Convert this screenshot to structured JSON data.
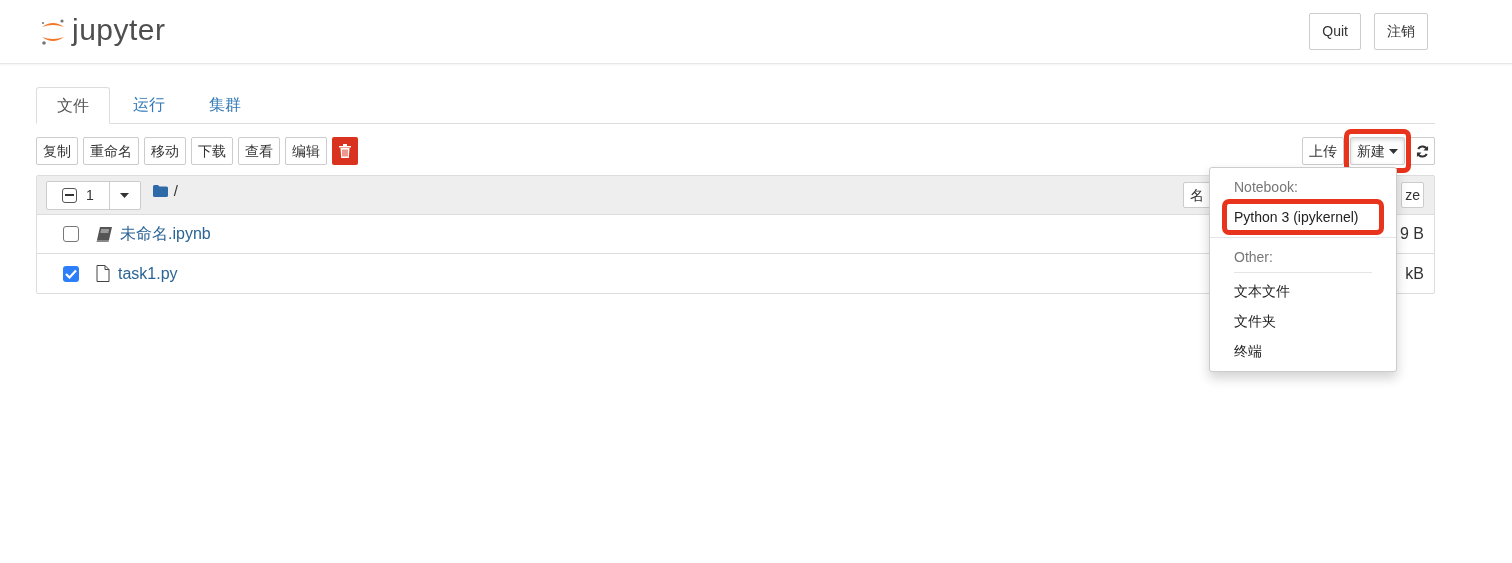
{
  "header": {
    "logo_text": "jupyter",
    "buttons": [
      "Quit",
      "注销"
    ]
  },
  "tabs": [
    {
      "label": "文件",
      "selected": true
    },
    {
      "label": "运行",
      "selected": false
    },
    {
      "label": "集群",
      "selected": false
    }
  ],
  "toolbar": {
    "actions": [
      "复制",
      "重命名",
      "移动",
      "下载",
      "查看",
      "编辑"
    ],
    "upload": "上传",
    "new": {
      "label": "新建",
      "pressed": true,
      "annotated": true
    }
  },
  "list": {
    "select_all": {
      "indeterminate": true
    },
    "selected_count": "1",
    "path": "/",
    "sort_buttons": [
      "名",
      "ze"
    ],
    "rows": [
      {
        "name": "未命名.ipynb",
        "kind": "notebook",
        "checked": false,
        "size": "9 B"
      },
      {
        "name": "task1.py",
        "kind": "file",
        "checked": true,
        "size": "kB"
      }
    ]
  },
  "new_menu": {
    "sections": [
      {
        "heading": "Notebook:",
        "items": [
          {
            "label": "Python 3 (ipykernel)",
            "annotated": true
          }
        ]
      },
      {
        "heading": "Other:",
        "items": [
          {
            "label": "文本文件",
            "annotated": false
          },
          {
            "label": "文件夹",
            "annotated": false
          },
          {
            "label": "终端",
            "annotated": false
          }
        ]
      }
    ]
  }
}
